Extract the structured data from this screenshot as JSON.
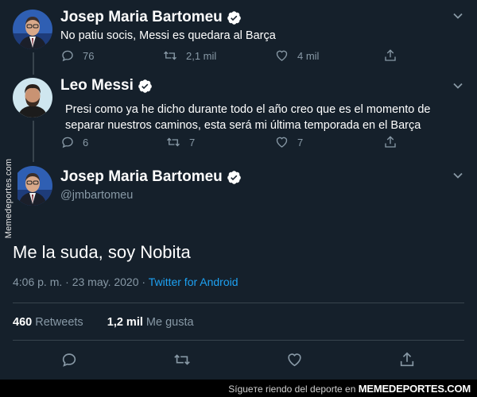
{
  "tweets": [
    {
      "name": "Josep Maria Bartomeu",
      "text": "No patiu socis, Messi es quedara al Barça",
      "replies": "76",
      "retweets": "2,1 mil",
      "likes": "4 mil"
    },
    {
      "name": "Leo Messi",
      "text": "Presi como ya he dicho durante todo el año creo que es el momento de separar nuestros caminos, esta será mi última temporada en el Barça",
      "replies": "6",
      "retweets": "7",
      "likes": "7"
    }
  ],
  "main_tweet": {
    "name": "Josep Maria Bartomeu",
    "handle": "@jmbartomeu",
    "text": "Me la suda, soy Nobita",
    "time": "4:06 p. m. · 23 may. 2020 · ",
    "source": "Twitter for Android",
    "retweets_count": "460",
    "retweets_label": " Retweets",
    "likes_count": "1,2 mil",
    "likes_label": " Me gusta"
  },
  "watermark": {
    "side": "Memedeportes.com",
    "footer_text": "Sígueте riendo del deporte en ",
    "footer_brand": "MEMEDEPORTES.COM"
  },
  "colors": {
    "background": "#15202b",
    "muted": "#8899a6",
    "link": "#1da1f2",
    "divider": "#38444d"
  },
  "icons": {
    "reply": "reply-icon",
    "retweet": "retweet-icon",
    "like": "heart-icon",
    "share": "share-icon",
    "verified": "verified-badge-icon",
    "more": "chevron-down-icon"
  }
}
